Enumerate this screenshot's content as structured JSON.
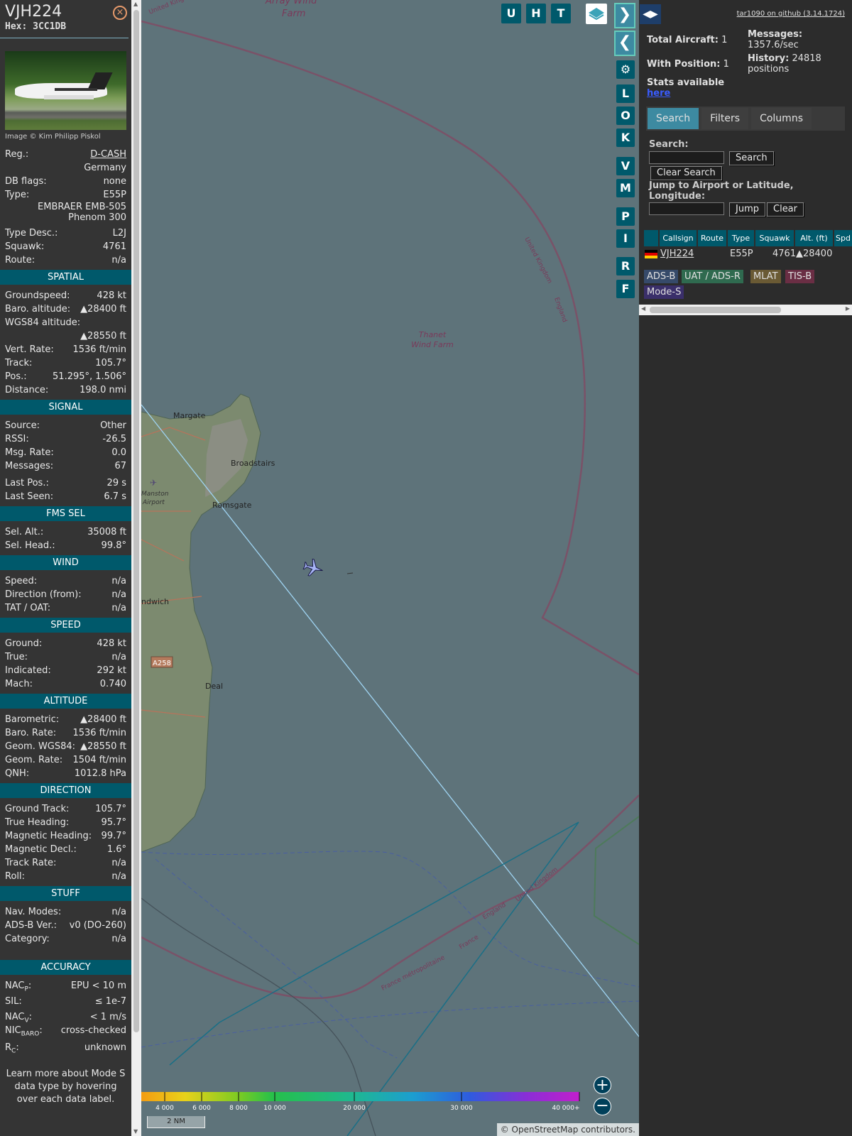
{
  "detail": {
    "callsign": "VJH224",
    "hex": "Hex: 3CC1DB",
    "close_icon": "×",
    "image_credit": "Image © Kim Philipp Piskol",
    "reg_label": "Reg.:",
    "reg": "D-CASH",
    "country": "Germany",
    "dbflags_label": "DB flags:",
    "dbflags": "none",
    "type_label": "Type:",
    "type": "E55P",
    "type_name_1": "EMBRAER EMB-505",
    "type_name_2": "Phenom 300",
    "typedesc_label": "Type Desc.:",
    "typedesc": "L2J",
    "squawk_label": "Squawk:",
    "squawk": "4761",
    "route_label": "Route:",
    "route": "n/a",
    "spatial": {
      "title": "SPATIAL",
      "gs_label": "Groundspeed:",
      "gs": "428 kt",
      "baro_label": "Baro. altitude:",
      "baro": "▲28400 ft",
      "wgs_label": "WGS84 altitude:",
      "wgs": "▲28550 ft",
      "vr_label": "Vert. Rate:",
      "vr": "1536 ft/min",
      "track_label": "Track:",
      "track": "105.7°",
      "pos_label": "Pos.:",
      "pos": "51.295°, 1.506°",
      "dist_label": "Distance:",
      "dist": "198.0 nmi"
    },
    "signal": {
      "title": "SIGNAL",
      "source_label": "Source:",
      "source": "Other",
      "rssi_label": "RSSI:",
      "rssi": "-26.5",
      "msgrate_label": "Msg. Rate:",
      "msgrate": "0.0",
      "messages_label": "Messages:",
      "messages": "67",
      "lastpos_label": "Last Pos.:",
      "lastpos": "29 s",
      "lastseen_label": "Last Seen:",
      "lastseen": "6.7 s"
    },
    "fms": {
      "title": "FMS SEL",
      "selalt_label": "Sel. Alt.:",
      "selalt": "35008 ft",
      "selhead_label": "Sel. Head.:",
      "selhead": "99.8°"
    },
    "wind": {
      "title": "WIND",
      "speed_label": "Speed:",
      "speed": "n/a",
      "dir_label": "Direction (from):",
      "dir": "n/a",
      "tat_label": "TAT / OAT:",
      "tat": "n/a"
    },
    "speed": {
      "title": "SPEED",
      "ground_label": "Ground:",
      "ground": "428 kt",
      "true_label": "True:",
      "true": "n/a",
      "ind_label": "Indicated:",
      "ind": "292 kt",
      "mach_label": "Mach:",
      "mach": "0.740"
    },
    "altitude": {
      "title": "ALTITUDE",
      "baro_label": "Barometric:",
      "baro": "▲28400 ft",
      "barorate_label": "Baro. Rate:",
      "barorate": "1536 ft/min",
      "geom_label": "Geom. WGS84:",
      "geom": "▲28550 ft",
      "geomrate_label": "Geom. Rate:",
      "geomrate": "1504 ft/min",
      "qnh_label": "QNH:",
      "qnh": "1012.8 hPa"
    },
    "direction": {
      "title": "DIRECTION",
      "gt_label": "Ground Track:",
      "gt": "105.7°",
      "th_label": "True Heading:",
      "th": "95.7°",
      "mh_label": "Magnetic Heading:",
      "mh": "99.7°",
      "md_label": "Magnetic Decl.:",
      "md": "1.6°",
      "tr_label": "Track Rate:",
      "tr": "n/a",
      "roll_label": "Roll:",
      "roll": "n/a"
    },
    "stuff": {
      "title": "STUFF",
      "nav_label": "Nav. Modes:",
      "nav": "n/a",
      "adsb_label": "ADS-B Ver.:",
      "adsb": "v0 (DO-260)",
      "cat_label": "Category:",
      "cat": "n/a"
    },
    "accuracy": {
      "title": "ACCURACY",
      "nacp_label": "NAC",
      "nacp_sub": "P",
      "nacp": "EPU < 10 m",
      "sil_label": "SIL:",
      "sil": "≤ 1e-7",
      "nacv_label": "NAC",
      "nacv_sub": "V",
      "nacv": "< 1 m/s",
      "nic_label": "NIC",
      "nic_sub": "BARO",
      "nic": "cross-checked",
      "rc_label": "R",
      "rc_sub": "C",
      "rc": "unknown"
    },
    "learn": "Learn more about Mode S data type by hovering over each data label."
  },
  "map": {
    "labels": {
      "arraywind": "Array Wind",
      "farm": "Farm",
      "thanet1": "Thanet",
      "thanet2": "Wind Farm",
      "margate": "Margate",
      "broadstairs": "Broadstairs",
      "ramsgate": "Ramsgate",
      "manston1": "Manston",
      "manston2": "Airport",
      "sandwich": "ndwich",
      "deal": "Deal",
      "a258": "A258",
      "uk_top": "United Kingdom",
      "uk_arc": "United Kingdom",
      "england_arc": "England",
      "england_low": "England",
      "uk_low": "United Kingdom",
      "france": "France",
      "france_metro": "France métropolitaine"
    },
    "buttons": {
      "u": "U",
      "h": "H",
      "t": "T",
      "l": "L",
      "o": "O",
      "k": "K",
      "v": "V",
      "m": "M",
      "p": "P",
      "i": "I",
      "r": "R",
      "f": "F"
    },
    "legend_ticks": [
      "4 000",
      "6 000",
      "8 000",
      "10 000",
      "20 000",
      "30 000",
      "40 000+"
    ],
    "scale": "2 NM",
    "attribution": "© OpenStreetMap contributors."
  },
  "panel": {
    "github": "tar1090 on github (3.14.1724)",
    "total_label": "Total Aircraft:",
    "total": "1",
    "msgs_label": "Messages:",
    "msgs": "1357.6/sec",
    "withpos_label": "With Position:",
    "withpos": "1",
    "history_label": "History:",
    "history": "24818",
    "history_unit": "positions",
    "stats_text": "Stats available",
    "stats_link": "here",
    "tabs": [
      "Search",
      "Filters",
      "Columns"
    ],
    "search_label": "Search:",
    "search_btn": "Search",
    "clear_search_btn": "Clear Search",
    "jump_label": "Jump to Airport or Latitude, Longitude:",
    "jump_btn": "Jump",
    "clear_btn": "Clear",
    "columns": [
      "Callsign",
      "Route",
      "Type",
      "Squawk",
      "Alt. (ft)",
      "Spd"
    ],
    "row": {
      "callsign": "VJH224",
      "type": "E55P",
      "squawk": "4761",
      "alt": "▲28400"
    },
    "tags": [
      "ADS-B",
      "UAT / ADS-R",
      "MLAT",
      "TIS-B",
      "Mode-S"
    ]
  },
  "colors": {
    "accent": "#00596b",
    "tab_active": "#3d8aa1",
    "sea": "#5e737a"
  }
}
